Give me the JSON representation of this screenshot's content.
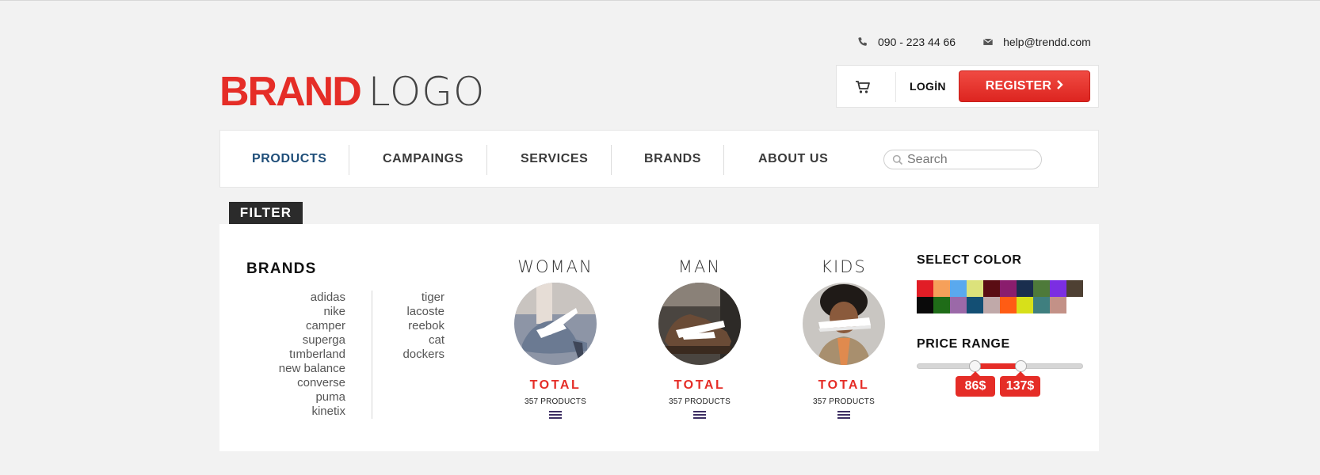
{
  "header": {
    "logo": {
      "bold": "BRAND",
      "light": "LOGO"
    },
    "phone": {
      "icon": "phone-icon",
      "text": "090 - 223 44 66"
    },
    "email": {
      "icon": "envelope-icon",
      "text": "help@trendd.com"
    },
    "cart_icon": "cart-icon",
    "login_label": "LOGİN",
    "register_label": "REGISTER",
    "register_icon": "chevron-right-icon"
  },
  "nav": {
    "items": [
      {
        "label": "PRODUCTS",
        "active": true
      },
      {
        "label": "CAMPAINGS",
        "active": false
      },
      {
        "label": "SERVICES",
        "active": false
      },
      {
        "label": "BRANDS",
        "active": false
      },
      {
        "label": "ABOUT US",
        "active": false
      }
    ],
    "search": {
      "placeholder": "Search",
      "value": "",
      "icon": "search-icon"
    }
  },
  "filter": {
    "tab_label": "FILTER",
    "brands": {
      "title": "BRANDS",
      "column1": [
        "adidas",
        "nike",
        "camper",
        "superga",
        "tımberland",
        "new balance",
        "converse",
        "puma",
        "kinetix"
      ],
      "column2": [
        "tiger",
        "lacoste",
        "reebok",
        "cat",
        "dockers"
      ]
    },
    "categories": [
      {
        "title": "WOMAN",
        "total_label": "TOTAL",
        "count": "357 PRODUCTS",
        "icon": "menu-icon"
      },
      {
        "title": "MAN",
        "total_label": "TOTAL",
        "count": "357 PRODUCTS",
        "icon": "menu-icon"
      },
      {
        "title": "KIDS",
        "total_label": "TOTAL",
        "count": "357 PRODUCTS",
        "icon": "menu-icon"
      }
    ],
    "colors": {
      "title": "SELECT COLOR",
      "swatches": [
        "#e11d26",
        "#f6a05a",
        "#5aa9ee",
        "#dce27b",
        "#5a0d13",
        "#8a1d6d",
        "#1a2e4e",
        "#4e7a3a",
        "#7b2ee2",
        "#4e4033",
        "#0a0a0a",
        "#1f6c18",
        "#9b69a8",
        "#134f74",
        "#c0a9a9",
        "#ff5c14",
        "#d7e01a",
        "#3f7f7f",
        "#c39187"
      ]
    },
    "price": {
      "title": "PRICE RANGE",
      "min_label": "86$",
      "max_label": "137$",
      "accent": "#e52d27"
    }
  }
}
